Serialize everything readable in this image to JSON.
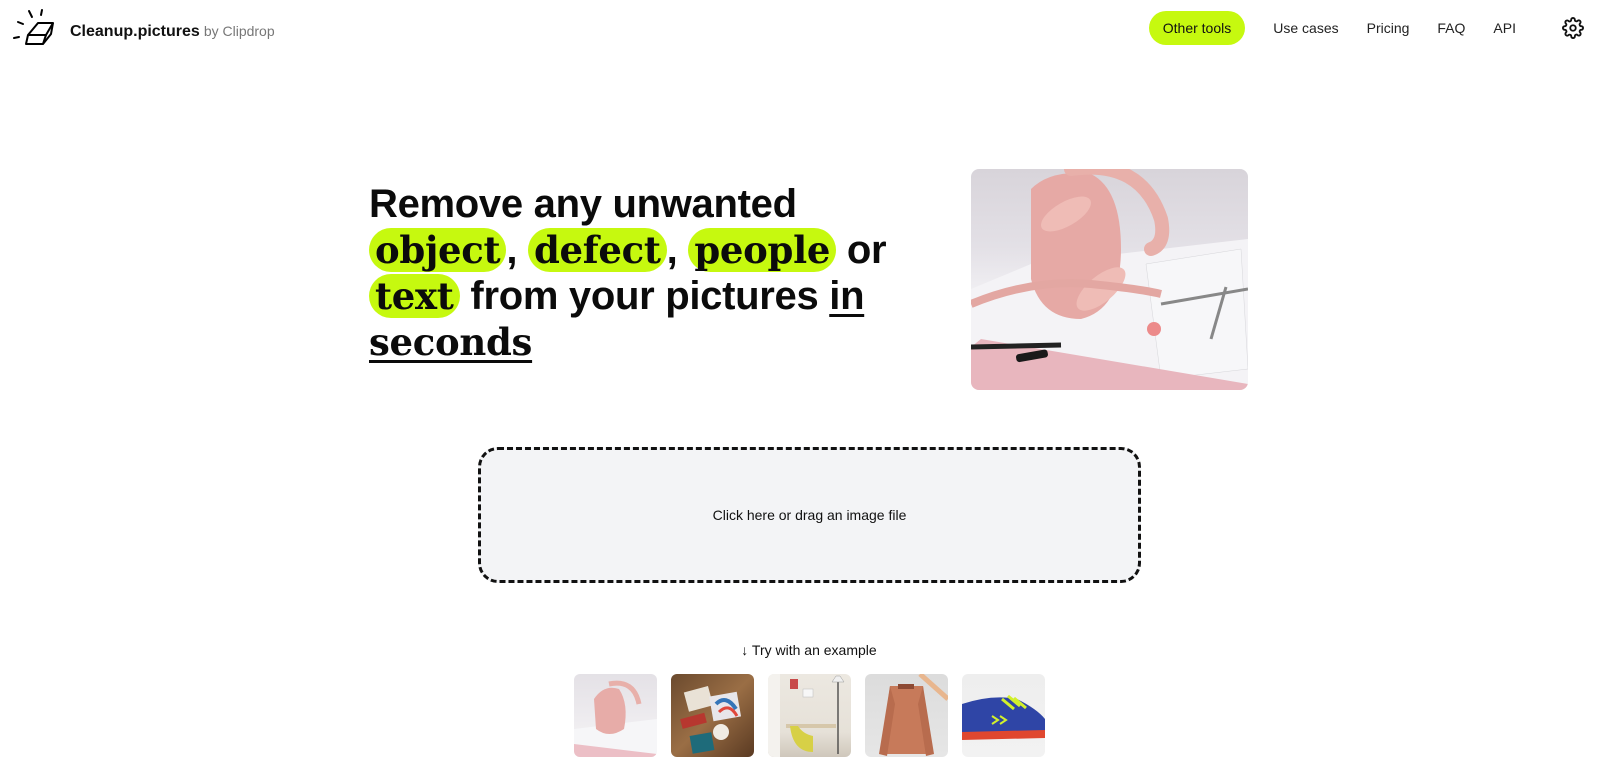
{
  "header": {
    "brand": "Cleanup.pictures",
    "brand_sub": "by Clipdrop",
    "logo_icon": "eraser-icon",
    "nav": [
      {
        "label": "Other tools",
        "highlighted": true
      },
      {
        "label": "Use cases"
      },
      {
        "label": "Pricing"
      },
      {
        "label": "FAQ"
      },
      {
        "label": "API"
      }
    ],
    "settings_icon": "gear-icon"
  },
  "hero": {
    "line1": "Remove any unwanted",
    "hl1": "object",
    "comma1": ",",
    "hl2": "defect",
    "comma2": ",",
    "hl3": "people",
    "or": "or",
    "hl4": "text",
    "mid": "from your pictures",
    "in": "in",
    "seconds": "seconds",
    "image_alt": "Pink handbag on a desk with ruler, pen and compass"
  },
  "upload": {
    "label": "Click here or drag an image file"
  },
  "examples": {
    "label": "↓ Try with an example",
    "items": [
      {
        "alt": "Pink handbag"
      },
      {
        "alt": "Desk with stationery"
      },
      {
        "alt": "Room with yellow chair"
      },
      {
        "alt": "Orange jacket"
      },
      {
        "alt": "Blue sneaker"
      }
    ]
  },
  "colors": {
    "accent": "#c6f90f",
    "dropzone_bg": "#f3f4f6",
    "text": "#111111"
  }
}
